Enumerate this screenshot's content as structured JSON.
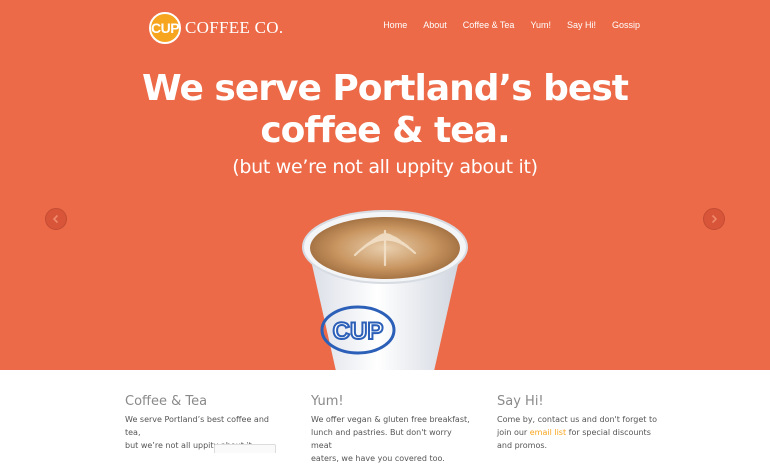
{
  "logo": {
    "badge": "CUP",
    "text": "COFFEE CO."
  },
  "nav": {
    "items": [
      {
        "label": "Home"
      },
      {
        "label": "About"
      },
      {
        "label": "Coffee & Tea"
      },
      {
        "label": "Yum!"
      },
      {
        "label": "Say Hi!"
      },
      {
        "label": "Gossip"
      }
    ]
  },
  "hero": {
    "headline_line1": "We serve Portland’s best",
    "headline_line2": "coffee & tea.",
    "subhead": "(but we’re not all uppity about it)",
    "cup_text": "CUP"
  },
  "columns": [
    {
      "title": "Coffee & Tea",
      "line1": "We serve Portland’s best coffee and tea,",
      "line2": "but we’re not all uppity about it."
    },
    {
      "title": "Yum!",
      "line1": "We offer vegan & gluten free breakfast,",
      "line2": "lunch and pastries. But don't worry meat",
      "line3": "eaters, we have you covered too."
    },
    {
      "title": "Say Hi!",
      "line1": "Come by, contact us and don't forget to",
      "line2_pre": "join our ",
      "link": "email list",
      "line2_post": " for special discounts",
      "line3": "and promos."
    }
  ],
  "colors": {
    "hero_bg": "#ec6a47",
    "accent": "#f7a51e",
    "cup_blue": "#2b5fb8"
  }
}
